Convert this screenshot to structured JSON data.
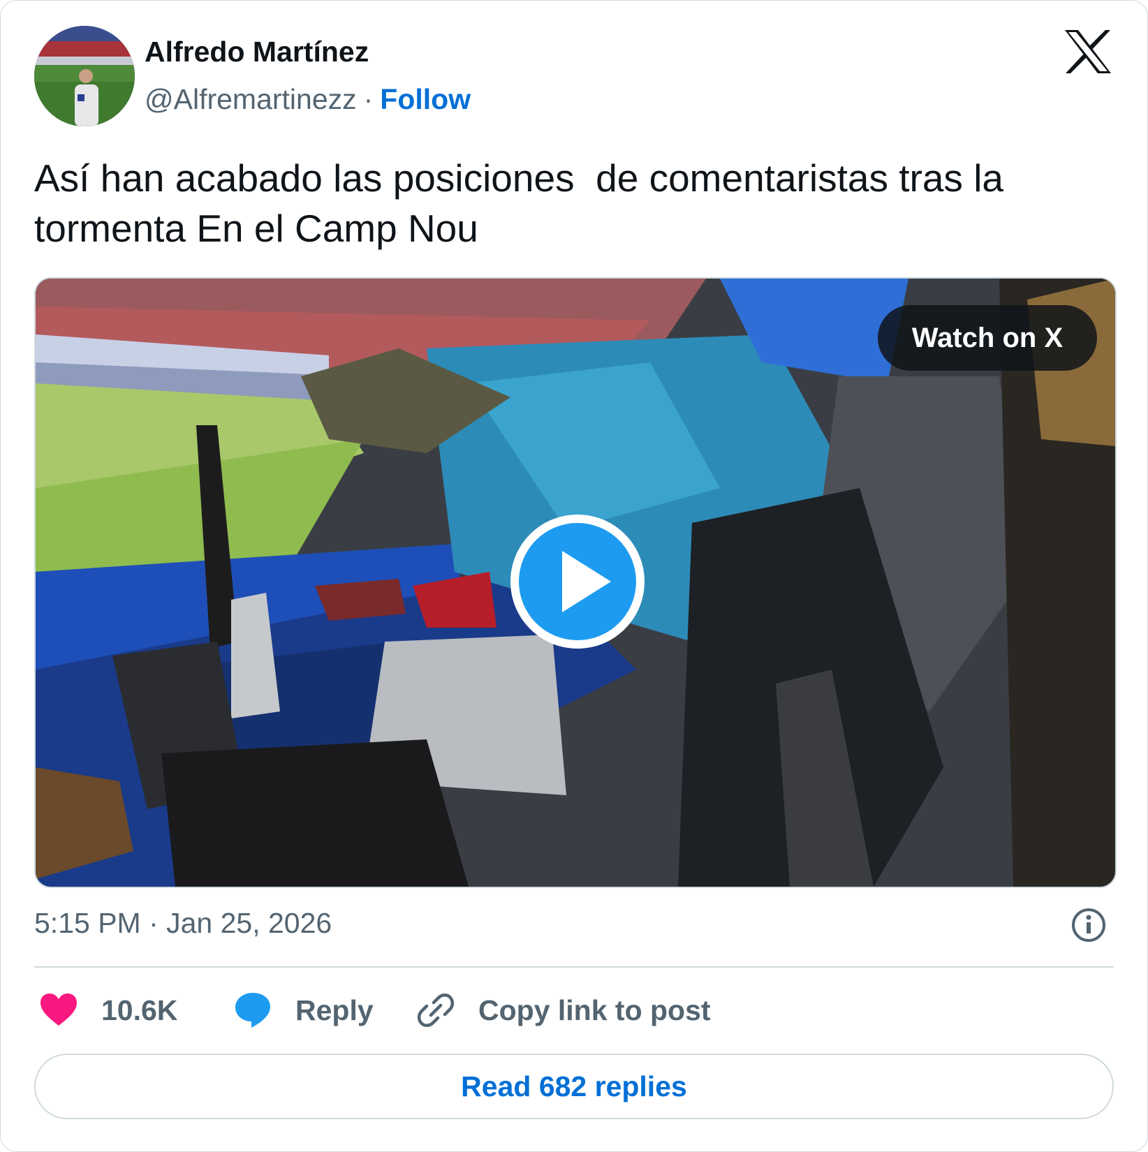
{
  "author": {
    "name": "Alfredo Martínez",
    "handle": "@Alfremartinezz",
    "separator": "·",
    "follow_label": "Follow",
    "avatar_icon": "stadium-portrait-avatar"
  },
  "brand": {
    "logo_icon": "x-logo-icon"
  },
  "post": {
    "text": "Así han acabado las posiciones  de comentaristas tras la tormenta En el Camp Nou",
    "timestamp": "5:15 PM · Jan 25, 2026"
  },
  "media": {
    "type": "video",
    "watch_label": "Watch on X",
    "play_icon": "play-icon"
  },
  "actions": {
    "like_count": "10.6K",
    "reply_label": "Reply",
    "copy_label": "Copy link to post"
  },
  "footer": {
    "read_replies_label": "Read 682 replies"
  },
  "colors": {
    "text_primary": "#0f1419",
    "text_secondary": "#536471",
    "link_blue": "#006fd6",
    "heart_pink": "#f91880",
    "reply_blue": "#1d9bf0",
    "border": "#cfd9de"
  }
}
